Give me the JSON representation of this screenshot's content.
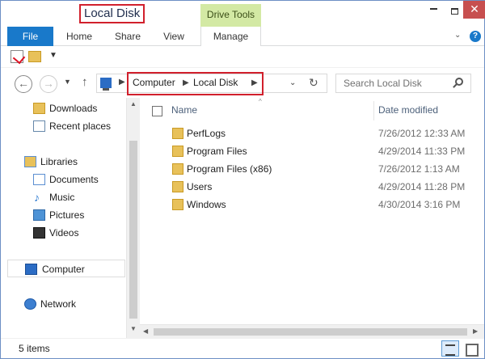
{
  "window": {
    "title": "Local Disk",
    "drive_tools_tab": "Drive Tools"
  },
  "ribbon": {
    "file": "File",
    "home": "Home",
    "share": "Share",
    "view": "View",
    "manage": "Manage",
    "help": "?"
  },
  "address": {
    "crumbs": [
      "Computer",
      "Local Disk"
    ],
    "search_placeholder": "Search Local Disk"
  },
  "nav": {
    "items": [
      {
        "label": "Downloads",
        "icon": "downloads-folder-icon"
      },
      {
        "label": "Recent places",
        "icon": "recent-places-icon"
      },
      {
        "label": "Libraries",
        "icon": "libraries-icon"
      },
      {
        "label": "Documents",
        "icon": "documents-icon"
      },
      {
        "label": "Music",
        "icon": "music-icon"
      },
      {
        "label": "Pictures",
        "icon": "pictures-icon"
      },
      {
        "label": "Videos",
        "icon": "videos-icon"
      },
      {
        "label": "Computer",
        "icon": "computer-icon"
      },
      {
        "label": "Network",
        "icon": "network-icon"
      }
    ]
  },
  "content": {
    "columns": {
      "name": "Name",
      "date": "Date modified"
    },
    "rows": [
      {
        "name": "PerfLogs",
        "date": "7/26/2012 12:33 AM"
      },
      {
        "name": "Program Files",
        "date": "4/29/2014 11:33 PM"
      },
      {
        "name": "Program Files (x86)",
        "date": "7/26/2012 1:13 AM"
      },
      {
        "name": "Users",
        "date": "4/29/2014 11:28 PM"
      },
      {
        "name": "Windows",
        "date": "4/30/2014 3:16 PM"
      }
    ]
  },
  "status": {
    "count": "5 items"
  },
  "colors": {
    "accent": "#1979ca",
    "drive_tools": "#d3e9a4",
    "highlight_box": "#d1202c"
  }
}
